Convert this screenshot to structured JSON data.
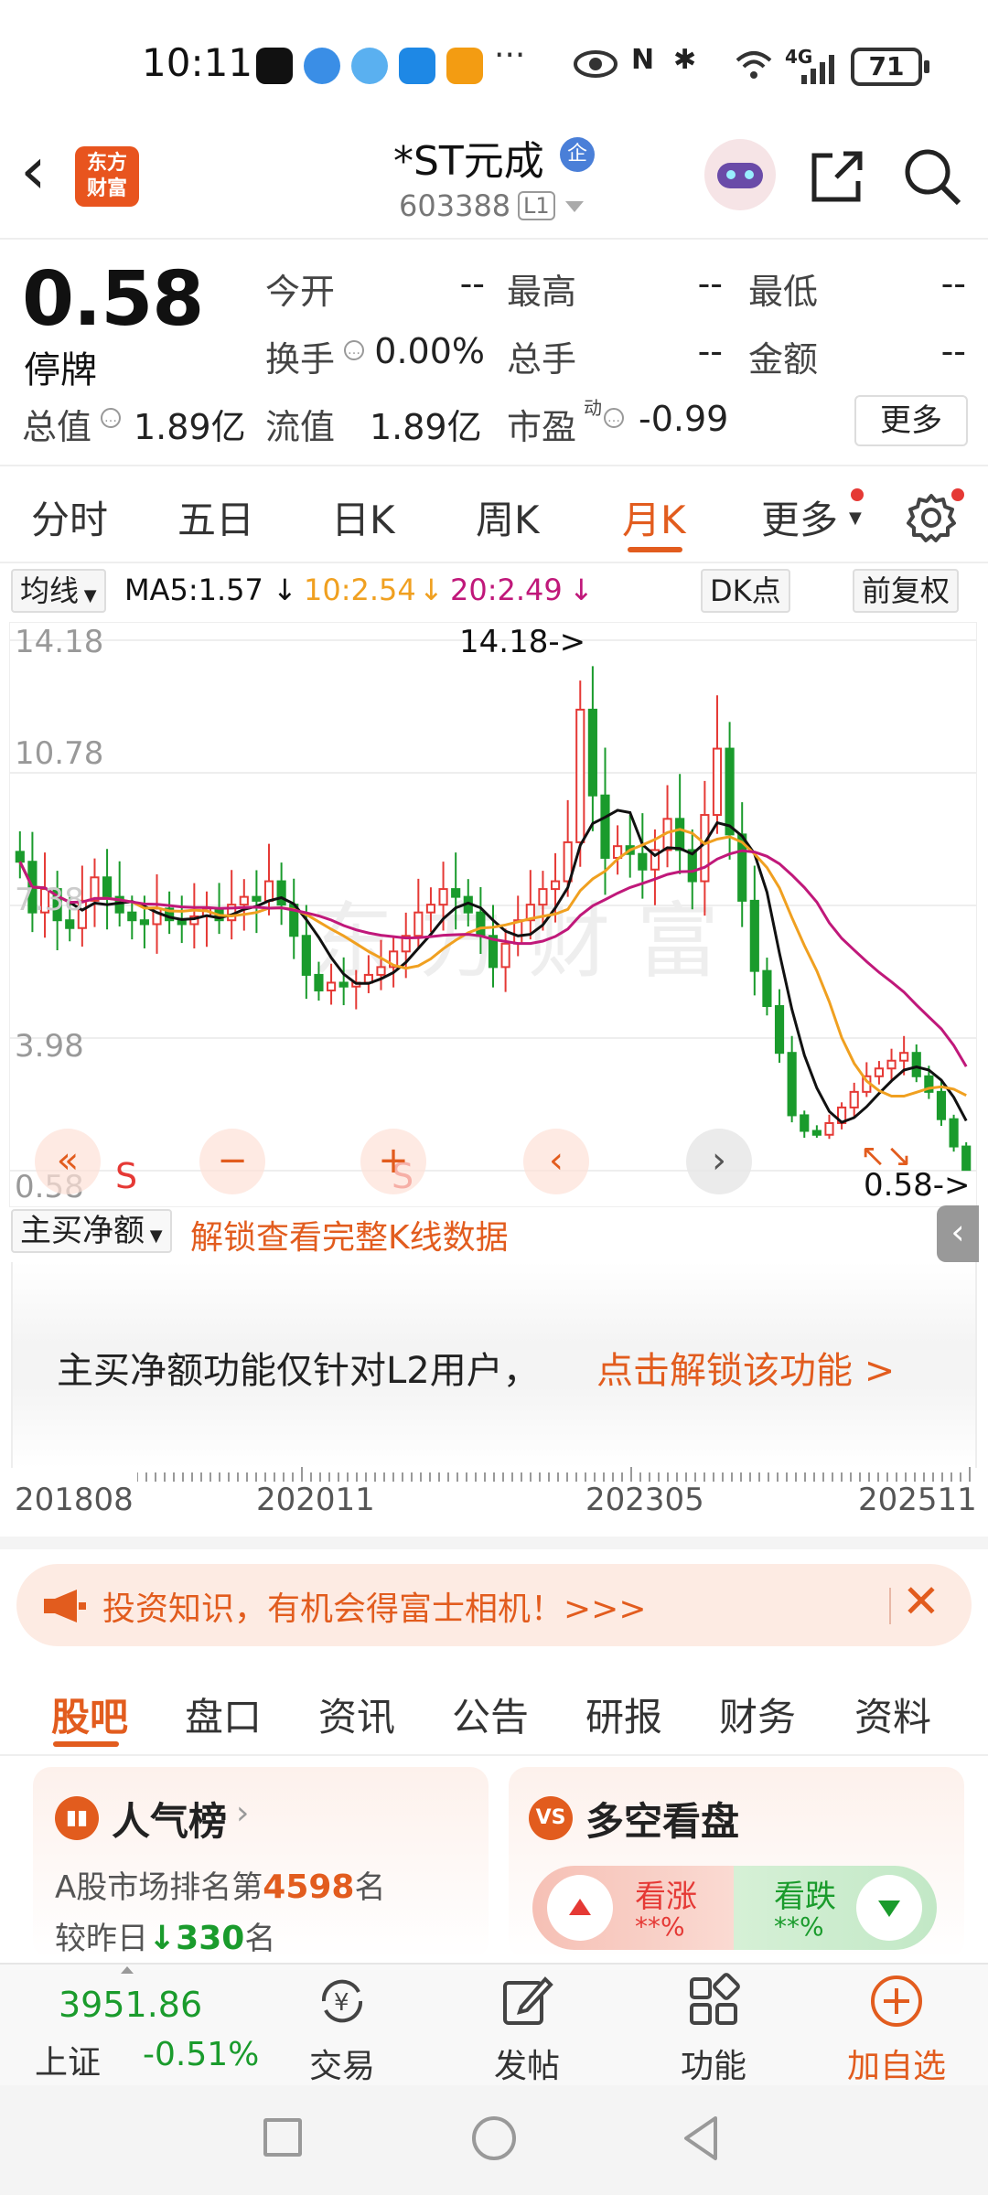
{
  "status_bar": {
    "time": "10:11",
    "dots": "···",
    "network": "4G",
    "battery": "71"
  },
  "header": {
    "back_icon": "chevron-left-icon",
    "logo_line1": "东方",
    "logo_line2": "财富",
    "stock_name": "*ST元成",
    "badge": "企",
    "stock_code": "603388",
    "level": "L1"
  },
  "quote": {
    "price": "0.58",
    "status": "停牌",
    "open_label": "今开",
    "open": "--",
    "high_label": "最高",
    "high": "--",
    "low_label": "最低",
    "low": "--",
    "turnover_label": "换手",
    "turnover": "0.00%",
    "volume_label": "总手",
    "volume": "--",
    "amount_label": "金额",
    "amount": "--",
    "mktcap_label": "总值",
    "mktcap": "1.89亿",
    "float_label": "流值",
    "float": "1.89亿",
    "pe_label": "市盈",
    "pe_sup": "动",
    "pe": "-0.99",
    "more": "更多"
  },
  "chart_tabs": [
    "分时",
    "五日",
    "日K",
    "周K",
    "月K",
    "更多"
  ],
  "active_chart_tab": "月K",
  "indicator": {
    "select": "均线",
    "ma5": "MA5:1.57",
    "ma10": "10:2.54",
    "ma20": "20:2.49",
    "dk": "DK点",
    "adjust": "前复权"
  },
  "colors": {
    "accent": "#e25c1e",
    "up": "#e53935",
    "down": "#1a9b2c",
    "ma5": "#111111",
    "ma10": "#f0a020",
    "ma20": "#c0187a"
  },
  "chart_data": {
    "type": "candlestick",
    "period": "monthly",
    "y_ticks": [
      "14.18",
      "10.78",
      "7.38",
      "3.98",
      "0.58"
    ],
    "ylim": [
      0.58,
      14.18
    ],
    "x_ticks": [
      "201808",
      "202011",
      "202305",
      "202511"
    ],
    "annotations": [
      "14.18->",
      "0.58->"
    ],
    "signals": [
      "S",
      "S"
    ],
    "ma_lines": [
      "MA5",
      "MA10",
      "MA20"
    ],
    "closes": [
      8.5,
      7.2,
      7.8,
      7.0,
      6.8,
      7.5,
      8.1,
      7.6,
      7.2,
      7.0,
      6.9,
      7.3,
      7.0,
      6.9,
      7.1,
      7.3,
      7.0,
      7.4,
      7.6,
      7.5,
      8.0,
      7.4,
      6.6,
      5.6,
      5.2,
      5.4,
      5.3,
      5.4,
      5.6,
      5.8,
      6.2,
      6.6,
      7.2,
      7.4,
      7.8,
      7.6,
      7.2,
      6.6,
      5.8,
      6.4,
      7.0,
      7.4,
      7.8,
      8.0,
      9.0,
      12.4,
      10.2,
      8.6,
      8.9,
      8.7,
      8.3,
      8.8,
      9.6,
      8.8,
      8.0,
      9.7,
      11.4,
      9.2,
      7.5,
      5.7,
      4.8,
      3.6,
      2.0,
      1.6,
      1.5,
      1.8,
      2.2,
      2.6,
      3.0,
      3.2,
      3.4,
      3.6,
      3.0,
      2.6,
      1.9,
      1.2,
      0.6
    ],
    "last_close": 0.58
  },
  "controls": [
    "fast-back-icon",
    "zoom-out-icon",
    "zoom-in-icon",
    "prev-icon",
    "next-icon"
  ],
  "sub_indicator": {
    "select": "主买净额",
    "unlock_text": "解锁查看完整K线数据",
    "lock_text": "主买净额功能仅针对L2用户，",
    "lock_link": "点击解锁该功能 >"
  },
  "banner": {
    "text": "投资知识，有机会得富士相机！>>>"
  },
  "content_tabs": [
    "股吧",
    "盘口",
    "资讯",
    "公告",
    "研报",
    "财务",
    "资料"
  ],
  "active_content_tab": "股吧",
  "popularity": {
    "title": "人气榜",
    "rank_prefix": "A股市场排名第",
    "rank": "4598",
    "rank_suffix": "名",
    "change_prefix": "较昨日",
    "change": "330",
    "change_suffix": "名"
  },
  "sentiment": {
    "title": "多空看盘",
    "bull_label": "看涨",
    "bull_pct": "**%",
    "bear_label": "看跌",
    "bear_pct": "**%"
  },
  "bottom_bar": {
    "index_value": "3951.86",
    "index_name": "上证",
    "index_change": "-0.51%",
    "nav": [
      "交易",
      "发帖",
      "功能",
      "加自选"
    ]
  }
}
